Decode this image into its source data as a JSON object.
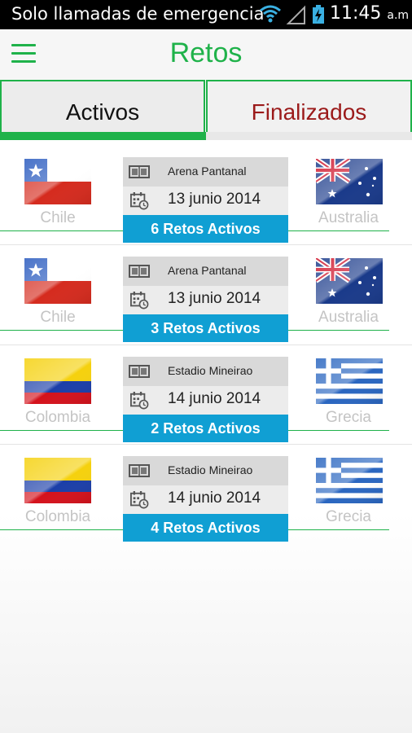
{
  "statusbar": {
    "carrier": "Solo llamadas de emergencia",
    "time": "11:45",
    "ampm": "a.m",
    "icons": [
      "wifi-icon",
      "signal-icon",
      "battery-charging-icon"
    ]
  },
  "appbar": {
    "title": "Retos",
    "menu_icon": "hamburger-menu-icon"
  },
  "tabs": [
    {
      "label": "Activos",
      "selected": true
    },
    {
      "label": "Finalizados",
      "selected": false
    }
  ],
  "colors": {
    "accent": "#1fb24a",
    "cta": "#109fd3",
    "inactive_tab_text": "#9b1a1a",
    "team_text": "#c4c4c4"
  },
  "matches": [
    {
      "home": "Chile",
      "away": "Australia",
      "venue": "Arena Pantanal",
      "date": "13 junio 2014",
      "cta": "6 Retos Activos"
    },
    {
      "home": "Chile",
      "away": "Australia",
      "venue": "Arena Pantanal",
      "date": "13 junio 2014",
      "cta": "3 Retos Activos"
    },
    {
      "home": "Colombia",
      "away": "Grecia",
      "venue": "Estadio Mineirao",
      "date": "14 junio 2014",
      "cta": "2 Retos Activos"
    },
    {
      "home": "Colombia",
      "away": "Grecia",
      "venue": "Estadio Mineirao",
      "date": "14 junio 2014",
      "cta": "4 Retos Activos"
    }
  ]
}
